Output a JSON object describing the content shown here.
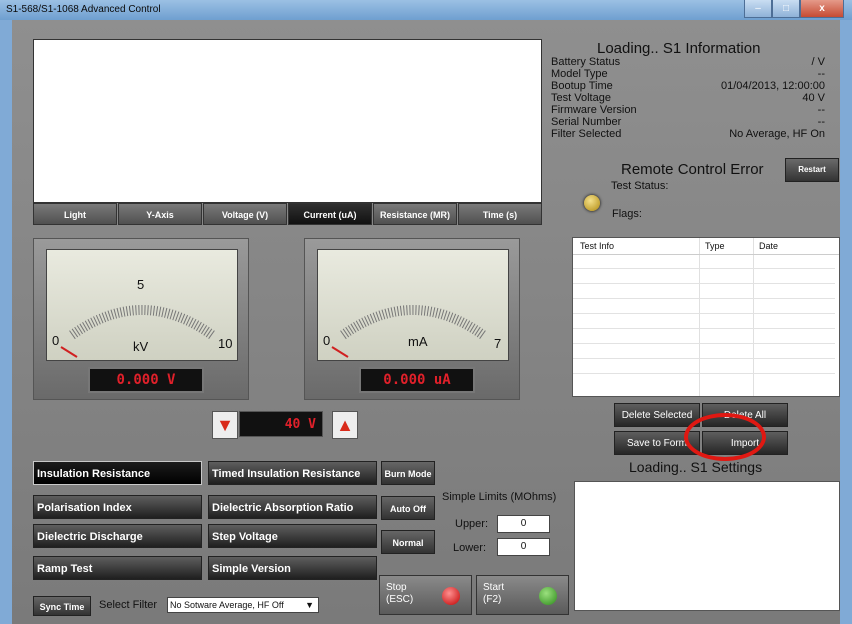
{
  "window": {
    "title": "S1-568/S1-1068 Advanced Control",
    "min": "–",
    "max": "□",
    "close": "x"
  },
  "tabs": [
    "Light",
    "Y-Axis",
    "Voltage (V)",
    "Current (uA)",
    "Resistance (MR)",
    "Time (s)"
  ],
  "info": {
    "loading": "Loading.. S1 Information",
    "rows": [
      {
        "k": "Battery Status",
        "v": "/ V"
      },
      {
        "k": "Model Type",
        "v": "--"
      },
      {
        "k": "Bootup Time",
        "v": "01/04/2013, 12:00:00"
      },
      {
        "k": "Test Voltage",
        "v": "40 V"
      },
      {
        "k": "Firmware Version",
        "v": "--"
      },
      {
        "k": "Serial Number",
        "v": "--"
      },
      {
        "k": "Filter Selected",
        "v": "No Average, HF On"
      }
    ],
    "remote_error": "Remote Control Error",
    "restart": "Restart",
    "test_status": "Test Status:",
    "flags": "Flags:"
  },
  "table": {
    "headers": [
      "Test Info",
      "Type",
      "Date"
    ]
  },
  "gauges": [
    {
      "top": "5",
      "left": "0",
      "right": "10",
      "unit": "kV",
      "display": "0.000 V"
    },
    {
      "left": "0",
      "right": "7",
      "unit": "mA",
      "display": "0.000 uA"
    }
  ],
  "voltage_display": "40 V",
  "modes": {
    "left": [
      "Insulation Resistance",
      "Polarisation Index",
      "Dielectric Discharge",
      "Ramp Test"
    ],
    "mid": [
      "Timed Insulation Resistance",
      "Dielectric Absorption Ratio",
      "Step Voltage",
      "Simple Version"
    ],
    "small": [
      "Burn Mode",
      "Auto Off",
      "Normal"
    ]
  },
  "limits": {
    "title": "Simple Limits (MOhms)",
    "upper_label": "Upper:",
    "upper": "0",
    "lower_label": "Lower:",
    "lower": "0"
  },
  "stop": {
    "line1": "Stop",
    "line2": "(ESC)",
    "led": "#e02222"
  },
  "start": {
    "line1": "Start",
    "line2": "(F2)",
    "led": "#3a9a28"
  },
  "actions": {
    "delete_selected": "Delete Selected",
    "delete_all": "Delete All",
    "save_to_form": "Save to Form",
    "import": "Import"
  },
  "settings_label": "Loading.. S1 Settings",
  "bottom": {
    "sync": "Sync Time",
    "filter_label": "Select Filter",
    "filter_value": "No Sotware Average, HF Off"
  }
}
